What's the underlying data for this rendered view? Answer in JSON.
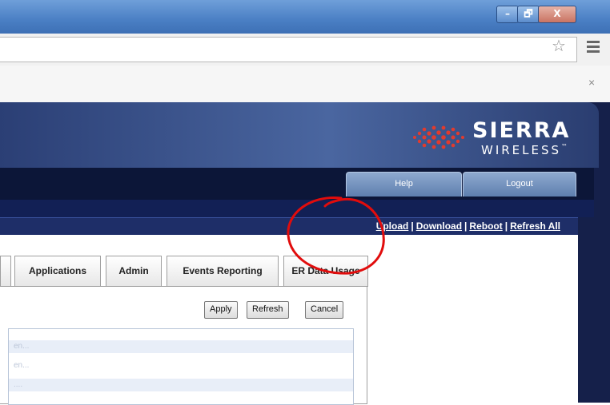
{
  "window": {
    "min_glyph": "–",
    "restore_glyph": "🗗",
    "close_glyph": "X"
  },
  "browser": {
    "star_icon": "☆",
    "close_glyph": "×"
  },
  "brand": {
    "name": "SIERRA",
    "sub": "WIRELESS",
    "tm": "™",
    "accent": "#e23b2e"
  },
  "nav": {
    "help": "Help",
    "logout": "Logout"
  },
  "actions": {
    "upload": "Upload",
    "download": "Download",
    "reboot": "Reboot",
    "refresh_all": "Refresh All",
    "separator": "|"
  },
  "tabs": {
    "applications": "Applications",
    "admin": "Admin",
    "events": "Events Reporting",
    "erdata": "ER Data Usage"
  },
  "buttons": {
    "apply": "Apply",
    "refresh": "Refresh",
    "cancel": "Cancel"
  },
  "list": {
    "row1": "en...",
    "row2": "en...",
    "row3": "...."
  }
}
